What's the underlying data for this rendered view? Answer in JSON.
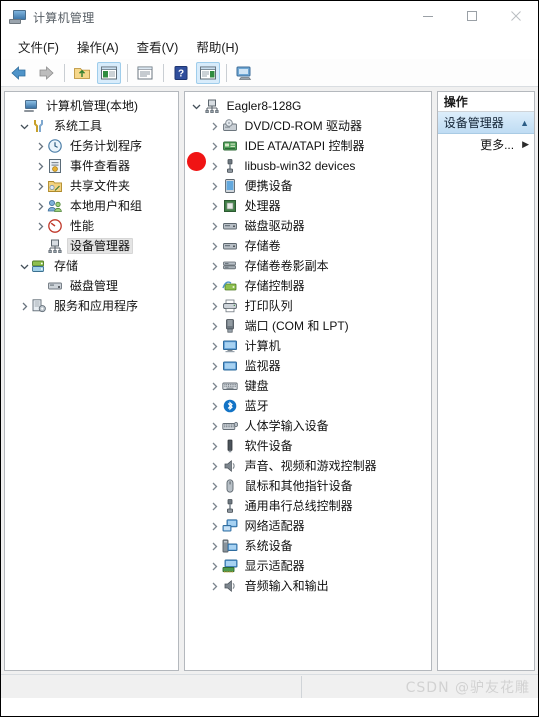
{
  "window": {
    "title": "计算机管理",
    "icon": "computer-management-icon",
    "controls": {
      "minimize": "—",
      "maximize": "□",
      "close": "✕"
    }
  },
  "menubar": {
    "items": [
      {
        "label": "文件(F)",
        "name": "menu-file"
      },
      {
        "label": "操作(A)",
        "name": "menu-action"
      },
      {
        "label": "查看(V)",
        "name": "menu-view"
      },
      {
        "label": "帮助(H)",
        "name": "menu-help"
      }
    ]
  },
  "toolbar": {
    "buttons": [
      {
        "name": "back-icon",
        "title": "后退",
        "active": false
      },
      {
        "name": "forward-icon",
        "title": "前进",
        "active": false
      },
      {
        "name": "up-folder-icon",
        "title": "向上",
        "active": false
      },
      {
        "name": "show-hide-console-tree-icon",
        "title": "显示/隐藏控制台树",
        "active": true
      },
      {
        "name": "properties-icon",
        "title": "属性",
        "active": false
      },
      {
        "name": "help-icon",
        "title": "帮助",
        "active": false
      },
      {
        "name": "show-hide-action-pane-icon",
        "title": "显示/隐藏操作窗格",
        "active": true
      },
      {
        "name": "scan-hardware-changes-icon",
        "title": "扫描检测硬件改动",
        "active": false
      }
    ]
  },
  "sidebar": {
    "root": {
      "label": "计算机管理(本地)",
      "icon": "computer-management-icon"
    },
    "items": [
      {
        "label": "系统工具",
        "icon": "tools-icon",
        "indent": 1,
        "chevron": "down"
      },
      {
        "label": "任务计划程序",
        "icon": "clock-icon",
        "indent": 2,
        "chevron": "right"
      },
      {
        "label": "事件查看器",
        "icon": "event-viewer-icon",
        "indent": 2,
        "chevron": "right"
      },
      {
        "label": "共享文件夹",
        "icon": "shared-folder-icon",
        "indent": 2,
        "chevron": "right"
      },
      {
        "label": "本地用户和组",
        "icon": "users-group-icon",
        "indent": 2,
        "chevron": "right"
      },
      {
        "label": "性能",
        "icon": "performance-icon",
        "indent": 2,
        "chevron": "right"
      },
      {
        "label": "设备管理器",
        "icon": "device-manager-icon",
        "indent": 2,
        "chevron": "none",
        "selected": true
      },
      {
        "label": "存储",
        "icon": "storage-icon",
        "indent": 1,
        "chevron": "down"
      },
      {
        "label": "磁盘管理",
        "icon": "disk-management-icon",
        "indent": 2,
        "chevron": "none"
      },
      {
        "label": "服务和应用程序",
        "icon": "services-apps-icon",
        "indent": 1,
        "chevron": "right"
      }
    ]
  },
  "device_tree": {
    "root": {
      "label": "Eagler8-128G",
      "icon": "computer-node-icon",
      "chevron": "down"
    },
    "items": [
      {
        "label": "DVD/CD-ROM 驱动器",
        "icon": "dvd-drive-icon",
        "chevron": "right"
      },
      {
        "label": "IDE ATA/ATAPI 控制器",
        "icon": "ide-controller-icon",
        "chevron": "right"
      },
      {
        "label": "libusb-win32 devices",
        "icon": "usb-device-icon",
        "chevron": "right",
        "annotated": true
      },
      {
        "label": "便携设备",
        "icon": "portable-device-icon",
        "chevron": "right"
      },
      {
        "label": "处理器",
        "icon": "processor-icon",
        "chevron": "right"
      },
      {
        "label": "磁盘驱动器",
        "icon": "disk-drive-icon",
        "chevron": "right"
      },
      {
        "label": "存储卷",
        "icon": "storage-volume-icon",
        "chevron": "right"
      },
      {
        "label": "存储卷卷影副本",
        "icon": "volume-shadow-copy-icon",
        "chevron": "right"
      },
      {
        "label": "存储控制器",
        "icon": "storage-controller-icon",
        "chevron": "right"
      },
      {
        "label": "打印队列",
        "icon": "print-queue-icon",
        "chevron": "right"
      },
      {
        "label": "端口 (COM 和 LPT)",
        "icon": "port-icon",
        "chevron": "right"
      },
      {
        "label": "计算机",
        "icon": "computer-icon",
        "chevron": "right"
      },
      {
        "label": "监视器",
        "icon": "monitor-icon",
        "chevron": "right"
      },
      {
        "label": "键盘",
        "icon": "keyboard-icon",
        "chevron": "right"
      },
      {
        "label": "蓝牙",
        "icon": "bluetooth-icon",
        "chevron": "right"
      },
      {
        "label": "人体学输入设备",
        "icon": "human-interface-device-icon",
        "chevron": "right"
      },
      {
        "label": "软件设备",
        "icon": "software-device-icon",
        "chevron": "right"
      },
      {
        "label": "声音、视频和游戏控制器",
        "icon": "sound-video-game-controller-icon",
        "chevron": "right"
      },
      {
        "label": "鼠标和其他指针设备",
        "icon": "mouse-icon",
        "chevron": "right"
      },
      {
        "label": "通用串行总线控制器",
        "icon": "usb-controller-icon",
        "chevron": "right"
      },
      {
        "label": "网络适配器",
        "icon": "network-adapter-icon",
        "chevron": "right"
      },
      {
        "label": "系统设备",
        "icon": "system-device-icon",
        "chevron": "right"
      },
      {
        "label": "显示适配器",
        "icon": "display-adapter-icon",
        "chevron": "right"
      },
      {
        "label": "音频输入和输出",
        "icon": "audio-input-output-icon",
        "chevron": "right"
      }
    ]
  },
  "actions_pane": {
    "header": "操作",
    "group": {
      "label": "设备管理器",
      "caret": "▲"
    },
    "items": [
      {
        "label": "更多...",
        "arrow": "▶"
      }
    ]
  },
  "statusbar": {
    "text": ""
  },
  "watermark": {
    "text": "CSDN @驴友花雕"
  },
  "colors": {
    "accent": "#d8ecfb",
    "annotation_red": "#f01414",
    "group_header_blue": "#bfdcf3",
    "selection_gray": "#e4e4e4"
  }
}
